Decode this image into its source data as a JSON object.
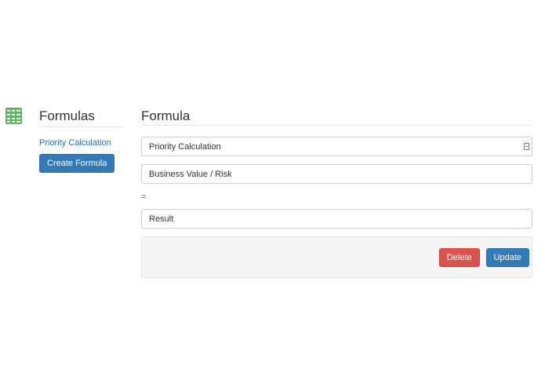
{
  "app": {
    "icon": "spreadsheet-grid-icon",
    "accent_color": "#5cb85c"
  },
  "sidebar": {
    "title": "Formulas",
    "items": [
      {
        "label": "Priority Calculation"
      }
    ],
    "create_label": "Create Formula"
  },
  "main": {
    "title": "Formula",
    "name_value": "Priority Calculation",
    "expression_value": "Business Value / Risk",
    "equals_label": "=",
    "result_value": "Result",
    "delete_label": "Delete",
    "update_label": "Update"
  },
  "colors": {
    "primary": "#337ab7",
    "danger": "#d9534f",
    "link": "#2a6eb4"
  }
}
